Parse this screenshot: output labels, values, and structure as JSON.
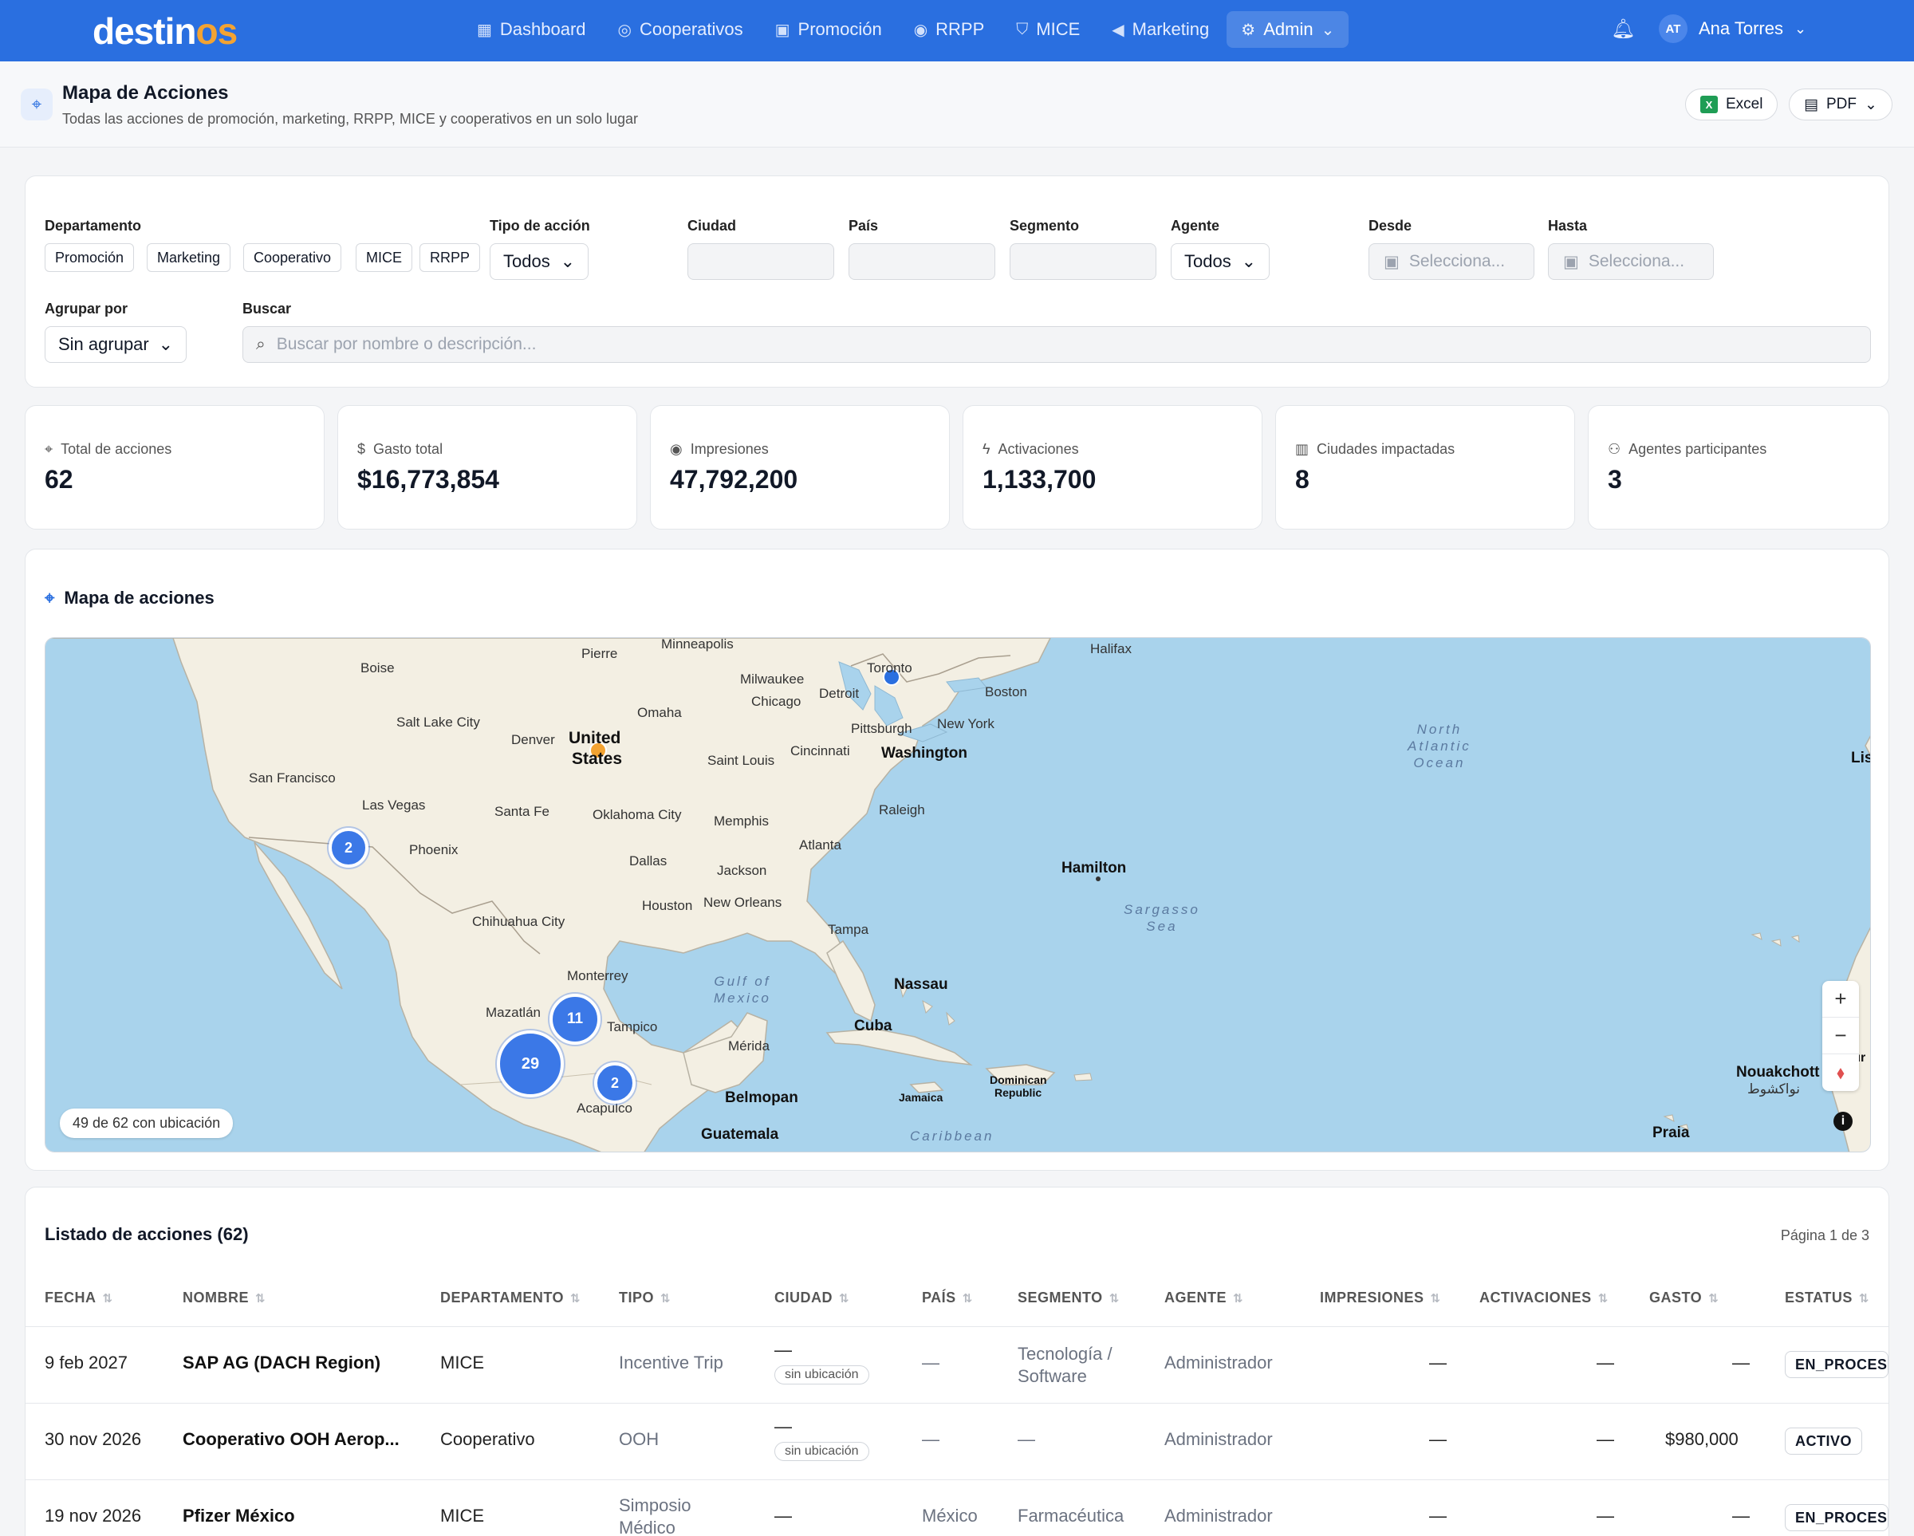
{
  "nav": {
    "logo_main": "destin",
    "logo_accent": "os",
    "links": [
      {
        "label": "Dashboard"
      },
      {
        "label": "Cooperativos"
      },
      {
        "label": "Promoción"
      },
      {
        "label": "RRPP"
      },
      {
        "label": "MICE"
      },
      {
        "label": "Marketing"
      },
      {
        "label": "Admin"
      }
    ],
    "user_initials": "AT",
    "user_name": "Ana Torres"
  },
  "header": {
    "title": "Mapa de Acciones",
    "subtitle": "Todas las acciones de promoción, marketing, RRPP, MICE y cooperativos en un solo lugar",
    "export_excel": "Excel",
    "export_pdf": "PDF"
  },
  "filters": {
    "departamento_label": "Departamento",
    "departamentos": [
      "Promoción",
      "Marketing",
      "Cooperativo",
      "MICE",
      "RRPP"
    ],
    "tipo_label": "Tipo de acción",
    "tipo_value": "Todos",
    "ciudad_label": "Ciudad",
    "pais_label": "País",
    "segmento_label": "Segmento",
    "agente_label": "Agente",
    "agente_value": "Todos",
    "desde_label": "Desde",
    "desde_placeholder": "Selecciona...",
    "hasta_label": "Hasta",
    "hasta_placeholder": "Selecciona...",
    "agrupar_label": "Agrupar por",
    "agrupar_value": "Sin agrupar",
    "buscar_label": "Buscar",
    "buscar_placeholder": "Buscar por nombre o descripción..."
  },
  "stats": [
    {
      "label": "Total de acciones",
      "value": "62",
      "icon": "pin-icon"
    },
    {
      "label": "Gasto total",
      "value": "$16,773,854",
      "icon": "dollar-icon"
    },
    {
      "label": "Impresiones",
      "value": "47,792,200",
      "icon": "eye-icon"
    },
    {
      "label": "Activaciones",
      "value": "1,133,700",
      "icon": "bolt-icon"
    },
    {
      "label": "Ciudades impactadas",
      "value": "8",
      "icon": "building-icon"
    },
    {
      "label": "Agentes participantes",
      "value": "3",
      "icon": "users-icon"
    }
  ],
  "map": {
    "title": "Mapa de acciones",
    "located_badge": "49 de 62 con ubicación",
    "clusters": [
      "2",
      "11",
      "29",
      "2"
    ],
    "places": {
      "minneapolis": "Minneapolis",
      "pierre": "Pierre",
      "boise": "Boise",
      "milwaukee": "Milwaukee",
      "chicago": "Chicago",
      "detroit": "Detroit",
      "toronto": "Toronto",
      "boston": "Boston",
      "halifax": "Halifax",
      "omaha": "Omaha",
      "saltlake": "Salt Lake City",
      "denver": "Denver",
      "us1": "United",
      "us2": "States",
      "pittsburgh": "Pittsburgh",
      "newyork": "New York",
      "washington": "Washington",
      "cincinnati": "Cincinnati",
      "stlouis": "Saint Louis",
      "sanfrancisco": "San Francisco",
      "lasvegas": "Las Vegas",
      "santafe": "Santa Fe",
      "okc": "Oklahoma City",
      "memphis": "Memphis",
      "raleigh": "Raleigh",
      "atlanta": "Atlanta",
      "phoenix": "Phoenix",
      "dallas": "Dallas",
      "jackson": "Jackson",
      "houston": "Houston",
      "neworleans": "New Orleans",
      "chihuahua": "Chihuahua City",
      "tampa": "Tampa",
      "hamilton": "Hamilton",
      "monterrey": "Monterrey",
      "nassau": "Nassau",
      "mazatlan": "Mazatlán",
      "tampico": "Tampico",
      "cuba": "Cuba",
      "merida": "Mérida",
      "acapulco": "Acapulco",
      "belmopan": "Belmopan",
      "jamaica": "Jamaica",
      "dominican1": "Dominican",
      "dominican2": "Republic",
      "guatemala": "Guatemala",
      "nouakchott": "Nouakchott",
      "nouakchott_ar": "نواكشوط",
      "praia": "Praia",
      "lis": "Lis",
      "maur": "Maur",
      "north_atlantic": "North\nAtlantic\nOcean",
      "sargasso": "Sargasso\nSea",
      "gulf": "Gulf of\nMexico",
      "caribbean": "Caribbean"
    }
  },
  "table": {
    "title": "Listado de acciones (62)",
    "page_info": "Página 1 de 3",
    "columns": [
      "FECHA",
      "NOMBRE",
      "DEPARTAMENTO",
      "TIPO",
      "CIUDAD",
      "PAÍS",
      "SEGMENTO",
      "AGENTE",
      "IMPRESIONES",
      "ACTIVACIONES",
      "GASTO",
      "ESTATUS"
    ],
    "no_location": "sin ubicación",
    "rows": [
      {
        "fecha": "9 feb 2027",
        "nombre": "SAP AG (DACH Region)",
        "departamento": "MICE",
        "tipo": "Incentive Trip",
        "ciudad": "—",
        "pais": "—",
        "segmento1": "Tecnología /",
        "segmento2": "Software",
        "agente": "Administrador",
        "impresiones": "—",
        "activaciones": "—",
        "gasto": "—",
        "estatus": "EN_PROCESO"
      },
      {
        "fecha": "30 nov 2026",
        "nombre": "Cooperativo OOH Aerop...",
        "departamento": "Cooperativo",
        "tipo": "OOH",
        "ciudad": "—",
        "pais": "—",
        "segmento1": "—",
        "segmento2": "",
        "agente": "Administrador",
        "impresiones": "—",
        "activaciones": "—",
        "gasto": "$980,000",
        "estatus": "ACTIVO"
      },
      {
        "fecha": "19 nov 2026",
        "nombre": "Pfizer México",
        "departamento": "MICE",
        "tipo1": "Simposio",
        "tipo2": "Médico",
        "ciudad": "—",
        "pais": "México",
        "segmento1": "Farmacéutica",
        "segmento2": "",
        "agente": "Administrador",
        "impresiones": "—",
        "activaciones": "—",
        "gasto": "—",
        "estatus": "EN_PROCESO"
      }
    ]
  },
  "colors": {
    "brand_blue": "#2a6fe0",
    "accent_orange": "#f3a332",
    "map_water": "#a9d3ec",
    "map_land": "#f3efe3",
    "cluster_blue": "#3b78e7"
  }
}
